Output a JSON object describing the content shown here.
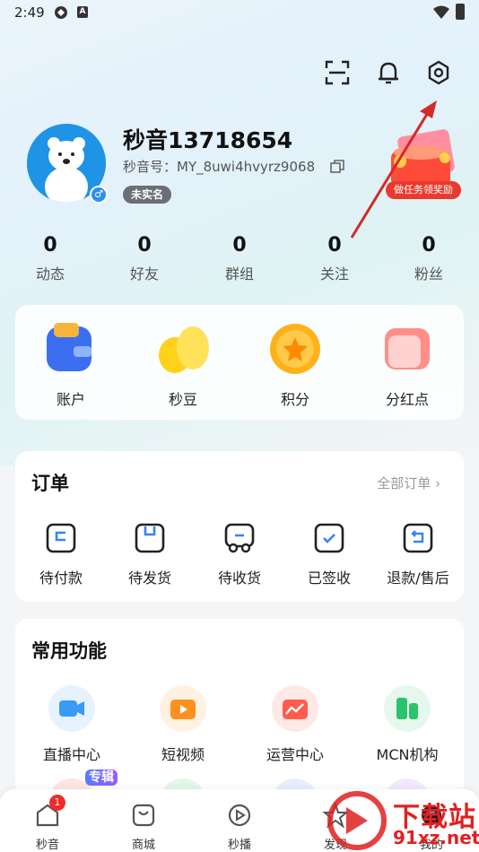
{
  "status_bar": {
    "time": "2:49",
    "icon_a": "A"
  },
  "header": {
    "icons": [
      "scan-icon",
      "bell-icon",
      "gear-icon"
    ]
  },
  "profile": {
    "username": "秒音13718654",
    "user_id": "秒音号：MY_8uwi4hvyrz9068",
    "realname_status": "未实名",
    "gender_symbol": "♂",
    "reward_label": "做任务领奖励"
  },
  "stats": [
    {
      "value": "0",
      "label": "动态"
    },
    {
      "value": "0",
      "label": "好友"
    },
    {
      "value": "0",
      "label": "群组"
    },
    {
      "value": "0",
      "label": "关注"
    },
    {
      "value": "0",
      "label": "粉丝"
    }
  ],
  "wallet": [
    {
      "label": "账户"
    },
    {
      "label": "秒豆"
    },
    {
      "label": "积分"
    },
    {
      "label": "分红点"
    }
  ],
  "orders": {
    "title": "订单",
    "all_label": "全部订单 ›",
    "items": [
      {
        "label": "待付款"
      },
      {
        "label": "待发货"
      },
      {
        "label": "待收货"
      },
      {
        "label": "已签收"
      },
      {
        "label": "退款/售后"
      }
    ]
  },
  "functions": {
    "title": "常用功能",
    "items": [
      {
        "label": "直播中心"
      },
      {
        "label": "短视频"
      },
      {
        "label": "运营中心"
      },
      {
        "label": "MCN机构"
      }
    ],
    "album_tag": "专辑"
  },
  "tab_bar": {
    "badge": "1",
    "items": [
      {
        "label": "秒音"
      },
      {
        "label": "商城"
      },
      {
        "label": "秒播"
      },
      {
        "label": "发现"
      },
      {
        "label": "我的"
      }
    ]
  },
  "watermark": {
    "line1": "下载站",
    "line2": "91xz.net"
  },
  "colors": {
    "accent_red": "#e12020",
    "badge_red": "#f22a2a",
    "annotation_arrow": "#d42a2a"
  }
}
